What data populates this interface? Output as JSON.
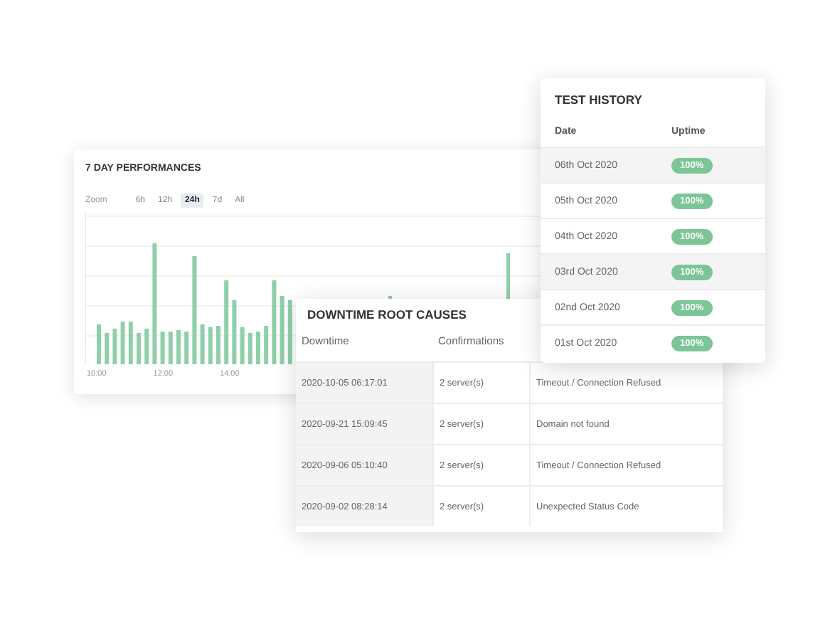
{
  "performance": {
    "title": "7 DAY PERFORMANCES",
    "zoom_label": "Zoom",
    "zoom_options": [
      {
        "label": "6h",
        "selected": false
      },
      {
        "label": "12h",
        "selected": false
      },
      {
        "label": "24h",
        "selected": true
      },
      {
        "label": "7d",
        "selected": false
      },
      {
        "label": "All",
        "selected": false
      }
    ],
    "x_labels": [
      "10:00",
      "12:00",
      "14:00"
    ]
  },
  "test_history": {
    "title": "TEST HISTORY",
    "columns": [
      "Date",
      "Uptime"
    ],
    "rows": [
      {
        "date": "06th Oct 2020",
        "uptime": "100%"
      },
      {
        "date": "05th Oct 2020",
        "uptime": "100%"
      },
      {
        "date": "04th Oct 2020",
        "uptime": "100%"
      },
      {
        "date": "03rd Oct 2020",
        "uptime": "100%"
      },
      {
        "date": "02nd Oct 2020",
        "uptime": "100%"
      },
      {
        "date": "01st Oct 2020",
        "uptime": "100%"
      }
    ]
  },
  "downtime_root_causes": {
    "title": "DOWNTIME ROOT CAUSES",
    "columns": [
      "Downtime",
      "Confirmations"
    ],
    "rows": [
      {
        "downtime": "2020-10-05 06:17:01",
        "confirmations": "2 server(s)",
        "column_3": "Timeout / Connection Refused"
      },
      {
        "downtime": "2020-09-21 15:09:45",
        "confirmations": "2 server(s)",
        "column_3": "Domain not found"
      },
      {
        "downtime": "2020-09-06 05:10:40",
        "confirmations": "2 server(s)",
        "column_3": "Timeout / Connection Refused"
      },
      {
        "downtime": "2020-09-02 08:28:14",
        "confirmations": "2 server(s)",
        "column_3": "Unexpected Status Code"
      }
    ]
  }
}
